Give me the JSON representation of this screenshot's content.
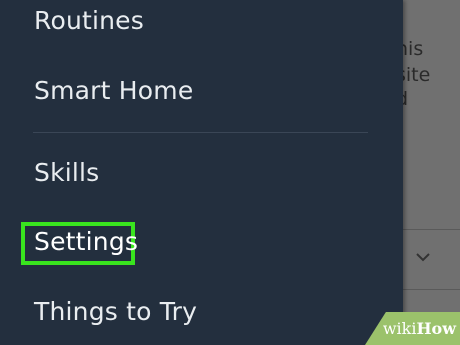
{
  "background": {
    "text_lines": [
      "his",
      "site",
      "d"
    ]
  },
  "drawer": {
    "items": [
      {
        "label": "Routines"
      },
      {
        "label": "Smart Home"
      },
      {
        "label": "Skills"
      },
      {
        "label": "Settings",
        "highlighted": true
      },
      {
        "label": "Things to Try"
      }
    ]
  },
  "watermark": {
    "wiki": "wiki",
    "how": "How"
  },
  "colors": {
    "drawer_bg": "#232f3e",
    "highlight": "#39e51e",
    "text": "#e9edf0"
  }
}
